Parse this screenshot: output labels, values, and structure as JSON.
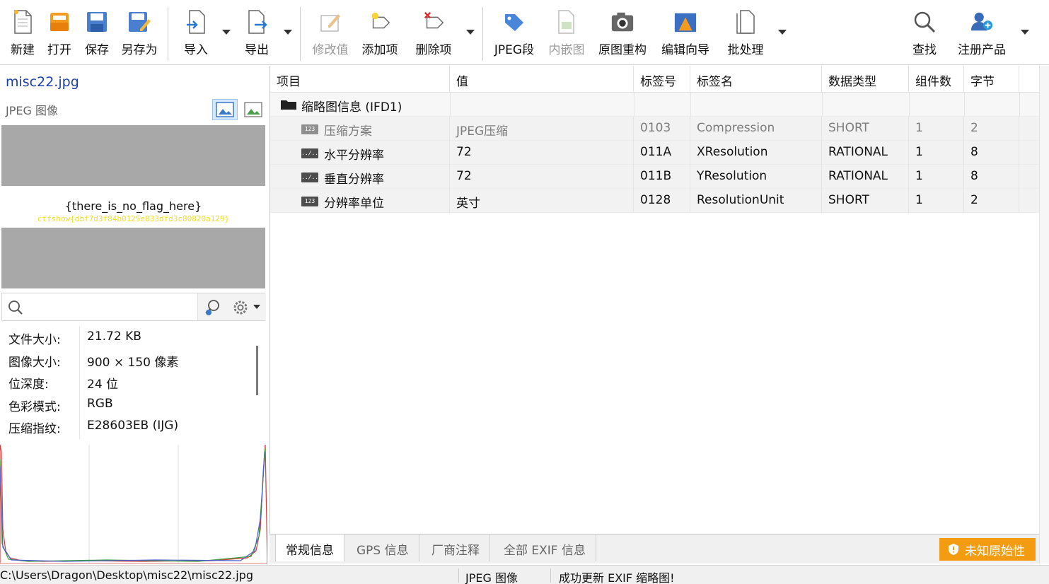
{
  "colors": {
    "accent_blue": "#1a3fa8",
    "warning_orange": "#f39c12",
    "flag_yellow": "#f2dd22"
  },
  "toolbar": {
    "new": "新建",
    "open": "打开",
    "save": "保存",
    "save_as": "另存为",
    "import": "导入",
    "export": "导出",
    "modify_value": "修改值",
    "add_item": "添加项",
    "delete_item": "删除项",
    "jpeg_segment": "JPEG段",
    "embedded_image": "内嵌图",
    "rebuild_original": "原图重构",
    "edit_wizard": "编辑向导",
    "batch": "批处理",
    "find": "查找",
    "register": "注册产品"
  },
  "left_panel": {
    "file_name": "misc22.jpg",
    "file_type": "JPEG 图像",
    "preview_text": "{there_is_no_flag_here}",
    "preview_flag": "ctfshow{dbf7d3f84b0125e833dfd3c80820a129}",
    "search_placeholder": "",
    "properties": [
      {
        "key": "文件大小:",
        "value": "21.72 KB"
      },
      {
        "key": "图像大小:",
        "value": "900 × 150 像素"
      },
      {
        "key": "位深度:",
        "value": "24 位"
      },
      {
        "key": "色彩模式:",
        "value": "RGB"
      },
      {
        "key": "压缩指纹:",
        "value": "E28603EB (IJG)"
      }
    ]
  },
  "table": {
    "headers": [
      "项目",
      "值",
      "标签号",
      "标签名",
      "数据类型",
      "组件数",
      "字节"
    ],
    "group": "缩略图信息 (IFD1)",
    "rows": [
      {
        "icon": "123",
        "item": "压缩方案",
        "value": "JPEG压缩",
        "tag": "0103",
        "name": "Compression",
        "type": "SHORT",
        "count": "1",
        "bytes": "2"
      },
      {
        "icon": "../..",
        "item": "水平分辨率",
        "value": "72",
        "tag": "011A",
        "name": "XResolution",
        "type": "RATIONAL",
        "count": "1",
        "bytes": "8"
      },
      {
        "icon": "../..",
        "item": "垂直分辨率",
        "value": "72",
        "tag": "011B",
        "name": "YResolution",
        "type": "RATIONAL",
        "count": "1",
        "bytes": "8"
      },
      {
        "icon": "123",
        "item": "分辨率单位",
        "value": "英寸",
        "tag": "0128",
        "name": "ResolutionUnit",
        "type": "SHORT",
        "count": "1",
        "bytes": "2"
      }
    ]
  },
  "tabs": [
    "常规信息",
    "GPS 信息",
    "厂商注释",
    "全部 EXIF 信息"
  ],
  "unknown_origin": "未知原始性",
  "status": {
    "path": "C:\\Users\\Dragon\\Desktop\\misc22\\misc22.jpg",
    "type": "JPEG 图像",
    "message": "成功更新 EXIF 缩略图!"
  }
}
